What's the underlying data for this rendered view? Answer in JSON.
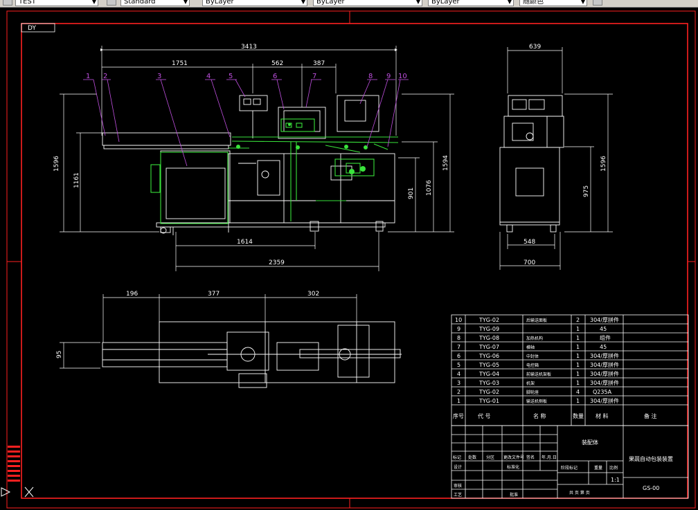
{
  "toolbar": {
    "layer_combo": "TEST",
    "textstyle_combo": "Standard",
    "color_combo": "ByLayer",
    "linetype_combo": "ByLayer",
    "lineweight_combo": "ByLayer",
    "plotstyle_combo": "随颜色"
  },
  "frame": {
    "corner_label": "DY"
  },
  "front_view": {
    "dims": {
      "overall": "3413",
      "left_span": "1751",
      "mid_span": "562",
      "right_span": "387",
      "height_total_left": "1596",
      "height_table": "1161",
      "height_right": "1594",
      "height_a": "1076",
      "height_b": "901",
      "base_1": "1614",
      "base_2": "2359"
    },
    "callouts": [
      "1",
      "2",
      "3",
      "4",
      "5",
      "6",
      "7",
      "8",
      "9",
      "10"
    ]
  },
  "side_view": {
    "dims": {
      "top_width": "639",
      "height_total": "1596",
      "height_body": "975",
      "foot_span": "548",
      "base_width": "700"
    }
  },
  "top_view": {
    "dims": {
      "seg_a": "196",
      "seg_b": "377",
      "seg_c": "302",
      "side": "95"
    }
  },
  "parts_table": {
    "rows": [
      {
        "no": "10",
        "code": "TYG-02",
        "name": "后输送面板",
        "qty": "2",
        "mat": "304/厚拼件"
      },
      {
        "no": "9",
        "code": "TYG-09",
        "name": "",
        "qty": "1",
        "mat": "45"
      },
      {
        "no": "8",
        "code": "TYG-08",
        "name": "加热机构",
        "qty": "1",
        "mat": "组件"
      },
      {
        "no": "7",
        "code": "TYG-07",
        "name": "横轴",
        "qty": "1",
        "mat": "45"
      },
      {
        "no": "6",
        "code": "TYG-06",
        "name": "中封体",
        "qty": "1",
        "mat": "304/厚拼件"
      },
      {
        "no": "5",
        "code": "TYG-05",
        "name": "电控箱",
        "qty": "1",
        "mat": "304/厚拼件"
      },
      {
        "no": "4",
        "code": "TYG-04",
        "name": "前输送机架板",
        "qty": "1",
        "mat": "304/厚拼件"
      },
      {
        "no": "3",
        "code": "TYG-03",
        "name": "机架",
        "qty": "1",
        "mat": "304/厚拼件"
      },
      {
        "no": "2",
        "code": "TYG-02",
        "name": "脚轮座",
        "qty": "4",
        "mat": "Q235A"
      },
      {
        "no": "1",
        "code": "TYG-01",
        "name": "输送机侧板",
        "qty": "1",
        "mat": "304/厚拼件"
      }
    ],
    "header": {
      "no": "序号",
      "code": "代 号",
      "name": "名 称",
      "qty": "数量",
      "mat": "材 料",
      "remark": "备 注"
    }
  },
  "title_block": {
    "assembly": "装配体",
    "title": "果蔬自动包装装置",
    "labels": [
      "标记",
      "处数",
      "分区",
      "更改文件号",
      "签名",
      "年.月.日",
      "设计",
      "标准化",
      "审核",
      "工艺",
      "批准",
      "阶段标记",
      "重量",
      "比例",
      "共 页 第 页"
    ],
    "scale": "1:1",
    "drawing_no": "GS-00"
  },
  "colors": {
    "frame": "#ff2020",
    "lines": "#ffffff",
    "highlight": "#39e23b",
    "callout": "#c050e0"
  }
}
